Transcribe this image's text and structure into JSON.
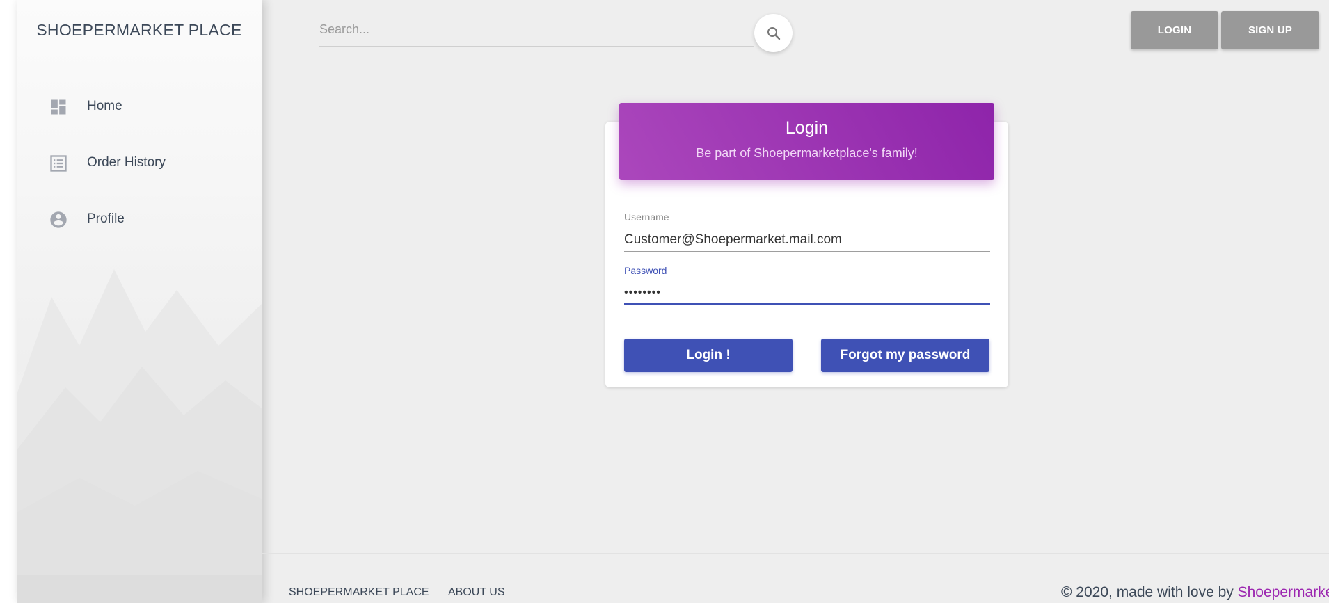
{
  "sidebar": {
    "brand": "SHOEPERMARKET PLACE",
    "items": [
      {
        "label": "Home",
        "icon": "dashboard-icon"
      },
      {
        "label": "Order History",
        "icon": "list-icon"
      },
      {
        "label": "Profile",
        "icon": "account-circle-icon"
      }
    ]
  },
  "header": {
    "search_placeholder": "Search...",
    "login_label": "LOGIN",
    "signup_label": "SIGN UP"
  },
  "login_card": {
    "title": "Login",
    "subtitle": "Be part of Shoepermarketplace's family!",
    "username_label": "Username",
    "username_value": "Customer@Shoepermarket.mail.com",
    "password_label": "Password",
    "password_value": "••••••••",
    "login_button": "Login !",
    "forgot_button": "Forgot my password"
  },
  "footer": {
    "links": [
      "SHOEPERMARKET PLACE",
      "ABOUT US"
    ],
    "copyright_prefix": "© 2020, made with love by ",
    "copyright_brand": "Shoepermarke"
  },
  "colors": {
    "accent": "#3f51b5",
    "header_gradient_start": "#ab47bc",
    "header_gradient_end": "#8e24aa",
    "top_button": "#999999"
  }
}
